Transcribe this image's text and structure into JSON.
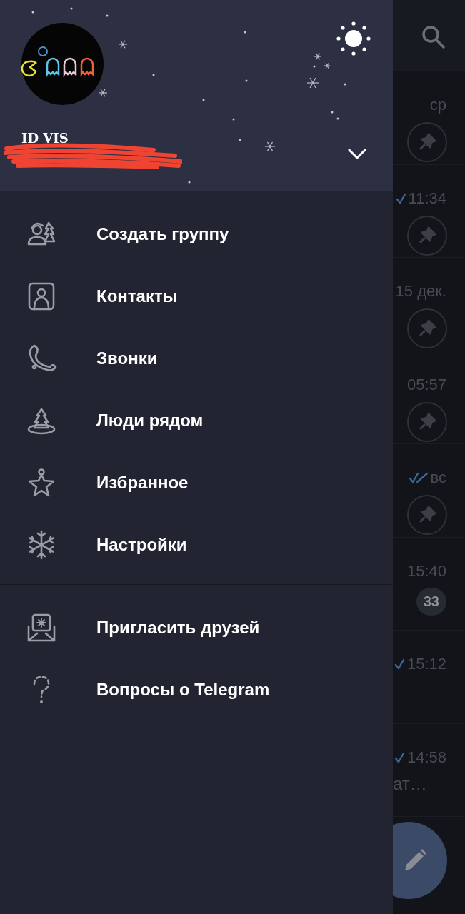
{
  "account": {
    "name": "ID VIS",
    "expanded": false
  },
  "sections": [
    {
      "items": [
        {
          "label": "Создать группу",
          "kind": "group"
        },
        {
          "label": "Контакты",
          "kind": "contacts"
        },
        {
          "label": "Звонки",
          "kind": "calls"
        },
        {
          "label": "Люди рядом",
          "kind": "nearby"
        },
        {
          "label": "Избранное",
          "kind": "saved"
        },
        {
          "label": "Настройки",
          "kind": "settings"
        }
      ]
    },
    {
      "items": [
        {
          "label": "Пригласить друзей",
          "kind": "invite"
        },
        {
          "label": "Вопросы о Telegram",
          "kind": "faq"
        }
      ]
    }
  ],
  "chats": [
    {
      "time": "ср",
      "sent": false,
      "pinned": true
    },
    {
      "time": "11:34",
      "sent": true,
      "read": false,
      "pinned": true
    },
    {
      "time": "15 дек.",
      "sent": false,
      "pinned": true
    },
    {
      "time": "05:57",
      "sent": false,
      "pinned": true
    },
    {
      "time": "вс",
      "sent": true,
      "read": true,
      "pinned": true
    },
    {
      "time": "15:40",
      "sent": false,
      "pinned": false,
      "unread": "33"
    },
    {
      "time": "15:12",
      "sent": true,
      "read": false,
      "pinned": false
    },
    {
      "time": "14:58",
      "sent": true,
      "read": false,
      "pinned": false,
      "preview": "ат…"
    }
  ]
}
